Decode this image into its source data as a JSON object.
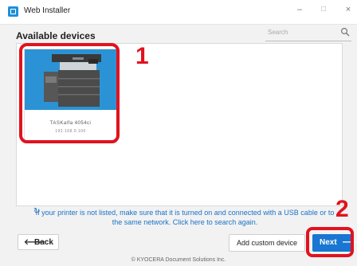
{
  "window": {
    "title": "Web Installer",
    "controls": {
      "minimize": "–",
      "maximize": "□",
      "close": "×"
    }
  },
  "main": {
    "heading": "Available devices",
    "search": {
      "placeholder": "Search",
      "icon": "search-icon"
    },
    "device": {
      "name": "TASKalfa 4054ci",
      "subtitle": "192.168.0.100",
      "image_icon": "printer-icon"
    },
    "hint": {
      "icon": "refresh-icon",
      "text": "If your printer is not listed, make sure that it is turned on and connected with a USB cable or to the same network. Click here to search again."
    }
  },
  "footer": {
    "back_label": "Back",
    "add_custom_label": "Add custom device",
    "next_label": "Next",
    "copyright": "© KYOCERA Document Solutions Inc."
  },
  "annotations": {
    "callout_1": "1",
    "callout_2": "2",
    "color": "#e0131e"
  },
  "colors": {
    "accent": "#1976d2",
    "link": "#1a73c6",
    "device_bg": "#2b93d5"
  }
}
